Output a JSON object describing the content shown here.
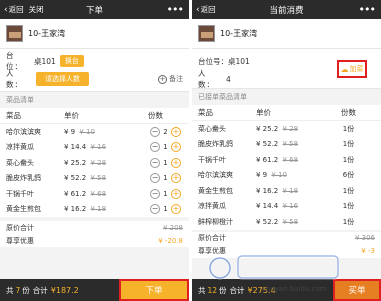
{
  "left": {
    "topbar": {
      "back": "返回",
      "close": "关闭",
      "title": "下单",
      "more": "•••"
    },
    "table_name": "10-王家湾",
    "info": {
      "table_label": "台 位：",
      "table_value": "桌101",
      "table_tag": "换台",
      "people_label": "人 数：",
      "people_tag": "请选择人数",
      "note_label": "备注"
    },
    "section": "菜品清单",
    "headers": {
      "name": "菜品",
      "price": "单价",
      "qty": "份数"
    },
    "items": [
      {
        "name": "哈尔滨滨爽",
        "price": "¥ 9",
        "old": "¥ 10",
        "qty": "2"
      },
      {
        "name": "凉拌黄瓜",
        "price": "¥ 14.4",
        "old": "¥ 16",
        "qty": "1"
      },
      {
        "name": "菜心鲞头",
        "price": "¥ 25.2",
        "old": "¥ 28",
        "qty": "1"
      },
      {
        "name": "脆皮炸乳鸽",
        "price": "¥ 52.2",
        "old": "¥ 58",
        "qty": "1"
      },
      {
        "name": "干锅千叶",
        "price": "¥ 61.2",
        "old": "¥ 68",
        "qty": "1"
      },
      {
        "name": "黄金生煎包",
        "price": "¥ 16.2",
        "old": "¥ 18",
        "qty": "1"
      }
    ],
    "totals": [
      {
        "label": "原价合计",
        "value": "¥ 208"
      },
      {
        "label": "尊享优惠",
        "value": "¥ -20.8"
      }
    ],
    "bottom": {
      "prefix": "共",
      "count": "7",
      "suffix": "份",
      "total_label": "合计",
      "total": "¥187.2",
      "submit": "下单"
    }
  },
  "right": {
    "topbar": {
      "back": "返回",
      "title": "当前消费",
      "more": "•••"
    },
    "table_name": "10-王家湾",
    "info": {
      "table_label": "台位号：",
      "table_value": "桌101",
      "people_label": "人 数：",
      "people_value": "4",
      "add_label": "加菜"
    },
    "section": "已接单菜品清单",
    "headers": {
      "name": "菜品",
      "price": "单价",
      "qty": "份数"
    },
    "items": [
      {
        "name": "菜心鲞头",
        "price": "¥ 25.2",
        "old": "¥ 28",
        "qty": "1份"
      },
      {
        "name": "脆皮炸乳鸽",
        "price": "¥ 52.2",
        "old": "¥ 58",
        "qty": "1份"
      },
      {
        "name": "干锅千叶",
        "price": "¥ 61.2",
        "old": "¥ 68",
        "qty": "1份"
      },
      {
        "name": "哈尔滨滨爽",
        "price": "¥ 9",
        "old": "¥ 10",
        "qty": "6份"
      },
      {
        "name": "黄金生煎包",
        "price": "¥ 16.2",
        "old": "¥ 18",
        "qty": "1份"
      },
      {
        "name": "凉拌黄瓜",
        "price": "¥ 14.4",
        "old": "¥ 16",
        "qty": "1份"
      },
      {
        "name": "鲜榨柳橙汁",
        "price": "¥ 52.2",
        "old": "¥ 58",
        "qty": "1份"
      }
    ],
    "totals": [
      {
        "label": "原价合计",
        "value": "¥ 306"
      },
      {
        "label": "尊享优惠",
        "value": "¥ -3"
      }
    ],
    "bottom": {
      "prefix": "共",
      "count": "12",
      "suffix": "份",
      "total_label": "合计",
      "total": "¥275.4",
      "submit": "买单"
    }
  },
  "watermark": "jingyan.baidu.com",
  "colors": {
    "accent": "#f5b22a",
    "bar": "#2b2b2b",
    "highlight_border": "#e02020"
  }
}
